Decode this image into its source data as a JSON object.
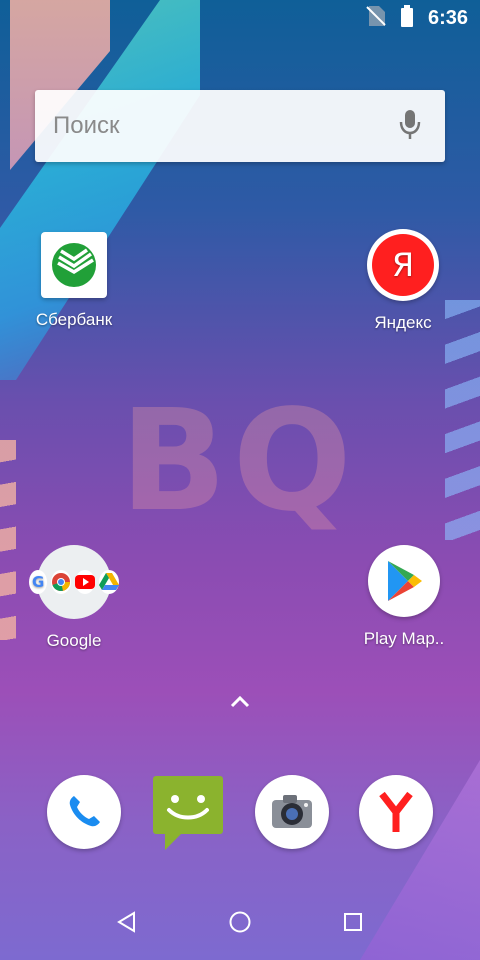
{
  "status": {
    "time": "6:36",
    "signal_icon": "no-sim-icon",
    "battery_icon": "battery-icon"
  },
  "wallpaper": {
    "logo_text": "BQ"
  },
  "search": {
    "placeholder": "Поиск",
    "mic_icon": "mic-icon"
  },
  "home_apps": [
    {
      "label": "Сбербанк",
      "icon": "sberbank-icon"
    },
    {
      "label": "Яндекс",
      "icon": "yandex-icon",
      "letter": "Я"
    },
    {
      "label": "Google",
      "icon": "google-folder-icon"
    },
    {
      "label": "Play Мар..",
      "icon": "play-market-icon"
    }
  ],
  "dock": [
    "phone-icon",
    "messaging-icon",
    "camera-icon",
    "yandex-browser-icon"
  ],
  "colors": {
    "sber_green": "#21a038",
    "yandex_red": "#ff0000",
    "messaging_green": "#8bb32e",
    "phone_blue": "#1a8cf0"
  }
}
